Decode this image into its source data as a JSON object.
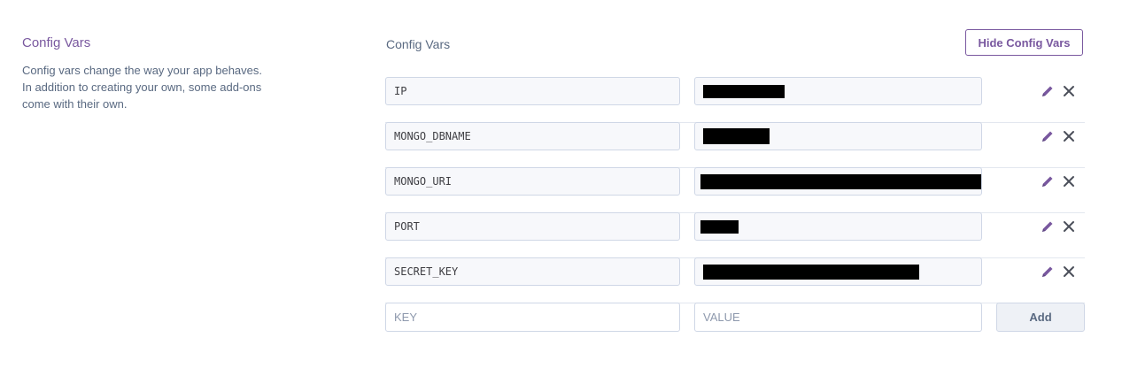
{
  "sidebar": {
    "title": "Config Vars",
    "description": "Config vars change the way your app behaves. In addition to creating your own, some add-ons come with their own."
  },
  "main": {
    "title": "Config Vars",
    "hide_button": "Hide Config Vars"
  },
  "config_vars": [
    {
      "key": "IP",
      "value_redacted": true
    },
    {
      "key": "MONGO_DBNAME",
      "value_redacted": true
    },
    {
      "key": "MONGO_URI",
      "value_redacted": true
    },
    {
      "key": "PORT",
      "value_redacted": true
    },
    {
      "key": "SECRET_KEY",
      "value_redacted": true
    }
  ],
  "new_var": {
    "key_placeholder": "KEY",
    "value_placeholder": "VALUE",
    "add_button": "Add"
  },
  "icons": {
    "edit": "pencil-icon",
    "delete": "close-icon"
  },
  "colors": {
    "accent": "#79589f",
    "icon": "#79589f",
    "redaction": "#000000"
  }
}
